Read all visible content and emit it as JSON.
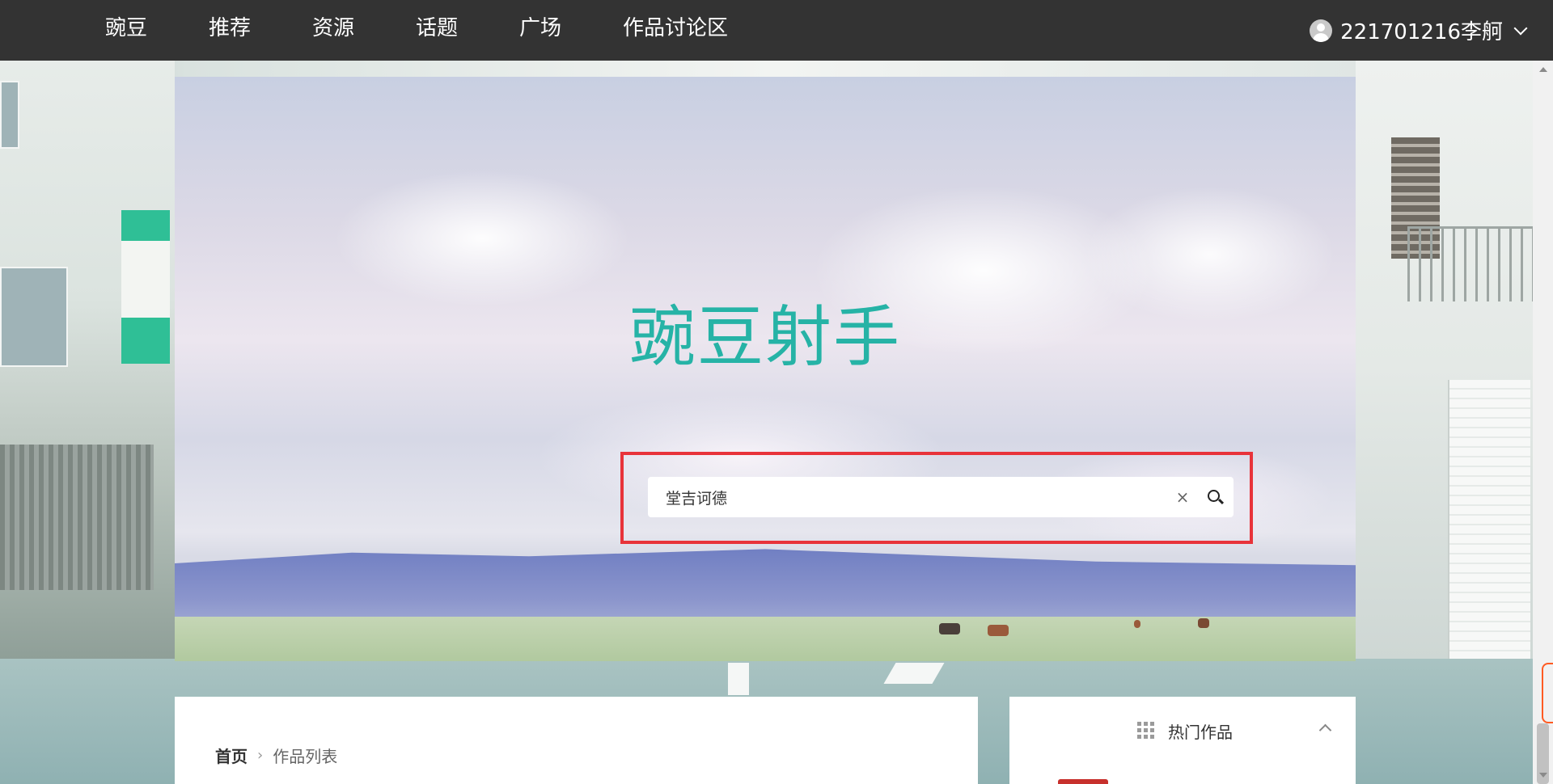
{
  "nav": {
    "items": [
      {
        "label": "豌豆"
      },
      {
        "label": "推荐"
      },
      {
        "label": "资源"
      },
      {
        "label": "话题"
      },
      {
        "label": "广场"
      },
      {
        "label": "作品讨论区"
      }
    ],
    "user": {
      "name": "221701216李舸",
      "icon": "user-avatar-icon"
    }
  },
  "hero": {
    "title": "豌豆射手",
    "search": {
      "value": "堂吉诃德",
      "clear_label": "×",
      "submit_icon": "search-icon"
    },
    "highlight_color": "#e8333a",
    "title_color": "#26b3a6"
  },
  "breadcrumb": {
    "home": "首页",
    "separator": "›",
    "current": "作品列表"
  },
  "sidebar": {
    "title": "热门作品",
    "icon": "grid-icon",
    "toggle_icon": "chevron-up-icon"
  },
  "colors": {
    "navbar": "#333333",
    "accent": "#26b3a6",
    "highlight": "#e8333a"
  }
}
